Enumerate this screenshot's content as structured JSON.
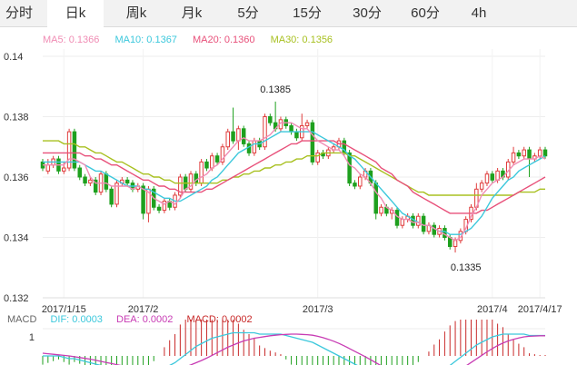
{
  "tabs": [
    {
      "label": "分时",
      "active": false
    },
    {
      "label": "日k",
      "active": true
    },
    {
      "label": "周k",
      "active": false
    },
    {
      "label": "月k",
      "active": false
    },
    {
      "label": "5分",
      "active": false
    },
    {
      "label": "15分",
      "active": false
    },
    {
      "label": "30分",
      "active": false
    },
    {
      "label": "60分",
      "active": false
    },
    {
      "label": "4h",
      "active": false
    }
  ],
  "legend": {
    "ma5": "MA5: 0.1366",
    "ma10": "MA10: 0.1367",
    "ma20": "MA20: 0.1360",
    "ma30": "MA30: 0.1356"
  },
  "macd_legend": {
    "title": "MACD",
    "dif": "DIF: 0.0003",
    "dea": "DEA: 0.0002",
    "macd": "MACD: 0.0002"
  },
  "colors": {
    "ma5": "#f08cb4",
    "ma10": "#3cc8dc",
    "ma20": "#e8507a",
    "ma30": "#a8c020",
    "up": "#e03c3c",
    "down": "#1ea01e",
    "dif": "#3cc8dc",
    "dea": "#c83cb4",
    "macd": "#c82828"
  },
  "chart_data": {
    "type": "candlestick",
    "y_ticks": [
      "0.14",
      "0.138",
      "0.136",
      "0.134",
      "0.132"
    ],
    "ylim": [
      0.132,
      0.14
    ],
    "x_labels": [
      {
        "label": "2017/1/15",
        "index": 4
      },
      {
        "label": "2017/2",
        "index": 19
      },
      {
        "label": "2017/3",
        "index": 52
      },
      {
        "label": "2017/4",
        "index": 85
      },
      {
        "label": "2017/4/17",
        "index": 94
      }
    ],
    "annotations": [
      {
        "text": "0.1385",
        "index": 44,
        "value": 0.1385
      },
      {
        "text": "0.1335",
        "index": 80,
        "value": 0.1335
      }
    ],
    "candles": [
      [
        0.1365,
        0.1363,
        0.1366,
        0.1362
      ],
      [
        0.1362,
        0.1364,
        0.1366,
        0.1361
      ],
      [
        0.1364,
        0.1366,
        0.1367,
        0.1363
      ],
      [
        0.1366,
        0.1362,
        0.1367,
        0.1361
      ],
      [
        0.1362,
        0.1363,
        0.1365,
        0.1361
      ],
      [
        0.1363,
        0.1375,
        0.1376,
        0.1362
      ],
      [
        0.1375,
        0.1363,
        0.1376,
        0.1362
      ],
      [
        0.1363,
        0.136,
        0.1364,
        0.1359
      ],
      [
        0.136,
        0.1358,
        0.1361,
        0.1357
      ],
      [
        0.1358,
        0.1359,
        0.136,
        0.1357
      ],
      [
        0.1359,
        0.1355,
        0.136,
        0.1354
      ],
      [
        0.1355,
        0.1361,
        0.1362,
        0.1354
      ],
      [
        0.1361,
        0.1356,
        0.1362,
        0.1355
      ],
      [
        0.1356,
        0.1351,
        0.1357,
        0.135
      ],
      [
        0.1351,
        0.1358,
        0.1359,
        0.135
      ],
      [
        0.1358,
        0.1359,
        0.136,
        0.1357
      ],
      [
        0.1359,
        0.1358,
        0.136,
        0.1357
      ],
      [
        0.1358,
        0.1356,
        0.1359,
        0.1355
      ],
      [
        0.1356,
        0.1357,
        0.1358,
        0.1355
      ],
      [
        0.1357,
        0.1348,
        0.1358,
        0.1346
      ],
      [
        0.1348,
        0.1356,
        0.1357,
        0.1345
      ],
      [
        0.1356,
        0.135,
        0.1357,
        0.1349
      ],
      [
        0.135,
        0.1349,
        0.1351,
        0.1348
      ],
      [
        0.1349,
        0.1352,
        0.1353,
        0.1348
      ],
      [
        0.1352,
        0.135,
        0.1353,
        0.1349
      ],
      [
        0.135,
        0.1354,
        0.1355,
        0.1349
      ],
      [
        0.1354,
        0.136,
        0.1361,
        0.1353
      ],
      [
        0.136,
        0.1356,
        0.1361,
        0.1355
      ],
      [
        0.1356,
        0.1361,
        0.1362,
        0.1355
      ],
      [
        0.1361,
        0.1358,
        0.1362,
        0.1357
      ],
      [
        0.1358,
        0.1365,
        0.1366,
        0.1357
      ],
      [
        0.1365,
        0.1363,
        0.1366,
        0.1362
      ],
      [
        0.1363,
        0.1367,
        0.1368,
        0.1362
      ],
      [
        0.1367,
        0.1365,
        0.1368,
        0.1364
      ],
      [
        0.1365,
        0.137,
        0.1371,
        0.1364
      ],
      [
        0.137,
        0.1375,
        0.1376,
        0.1369
      ],
      [
        0.1375,
        0.1372,
        0.1383,
        0.1371
      ],
      [
        0.1372,
        0.1376,
        0.1377,
        0.1369
      ],
      [
        0.1376,
        0.1371,
        0.1377,
        0.137
      ],
      [
        0.1371,
        0.1368,
        0.1372,
        0.1367
      ],
      [
        0.1368,
        0.1372,
        0.1373,
        0.1367
      ],
      [
        0.1372,
        0.137,
        0.1373,
        0.1369
      ],
      [
        0.137,
        0.138,
        0.1381,
        0.1369
      ],
      [
        0.138,
        0.1378,
        0.1381,
        0.1377
      ],
      [
        0.1378,
        0.1376,
        0.1385,
        0.1375
      ],
      [
        0.1376,
        0.1379,
        0.138,
        0.1375
      ],
      [
        0.1379,
        0.1377,
        0.138,
        0.1376
      ],
      [
        0.1377,
        0.1375,
        0.1378,
        0.1374
      ],
      [
        0.1375,
        0.1373,
        0.1376,
        0.1372
      ],
      [
        0.1373,
        0.1377,
        0.1381,
        0.1372
      ],
      [
        0.1377,
        0.1378,
        0.1379,
        0.1376
      ],
      [
        0.1378,
        0.1365,
        0.1379,
        0.1364
      ],
      [
        0.1365,
        0.1368,
        0.1369,
        0.1364
      ],
      [
        0.1368,
        0.1367,
        0.1369,
        0.1366
      ],
      [
        0.1367,
        0.1369,
        0.137,
        0.1366
      ],
      [
        0.1369,
        0.137,
        0.1371,
        0.1368
      ],
      [
        0.137,
        0.1372,
        0.1373,
        0.1369
      ],
      [
        0.1372,
        0.1368,
        0.1373,
        0.1367
      ],
      [
        0.1368,
        0.1358,
        0.1369,
        0.1357
      ],
      [
        0.1358,
        0.1357,
        0.1359,
        0.1356
      ],
      [
        0.1357,
        0.136,
        0.1361,
        0.1356
      ],
      [
        0.136,
        0.1362,
        0.1363,
        0.1359
      ],
      [
        0.1362,
        0.1358,
        0.1363,
        0.1357
      ],
      [
        0.1358,
        0.1348,
        0.1359,
        0.1346
      ],
      [
        0.1348,
        0.135,
        0.1351,
        0.1347
      ],
      [
        0.135,
        0.1348,
        0.1351,
        0.1347
      ],
      [
        0.1348,
        0.1349,
        0.135,
        0.1346
      ],
      [
        0.1349,
        0.1344,
        0.135,
        0.1343
      ],
      [
        0.1344,
        0.1346,
        0.1347,
        0.1343
      ],
      [
        0.1346,
        0.1347,
        0.1348,
        0.1345
      ],
      [
        0.1347,
        0.1344,
        0.1348,
        0.1343
      ],
      [
        0.1344,
        0.1347,
        0.1348,
        0.1343
      ],
      [
        0.1347,
        0.1342,
        0.1348,
        0.1341
      ],
      [
        0.1342,
        0.1344,
        0.1345,
        0.1341
      ],
      [
        0.1344,
        0.1341,
        0.1345,
        0.134
      ],
      [
        0.1341,
        0.1343,
        0.1344,
        0.134
      ],
      [
        0.1343,
        0.134,
        0.1344,
        0.1339
      ],
      [
        0.134,
        0.1337,
        0.1341,
        0.1336
      ],
      [
        0.1337,
        0.1339,
        0.134,
        0.1335
      ],
      [
        0.1339,
        0.1342,
        0.1343,
        0.1338
      ],
      [
        0.1342,
        0.1346,
        0.1347,
        0.1341
      ],
      [
        0.1346,
        0.135,
        0.1351,
        0.1345
      ],
      [
        0.135,
        0.1356,
        0.1358,
        0.1349
      ],
      [
        0.1356,
        0.1358,
        0.1359,
        0.1355
      ],
      [
        0.1358,
        0.1361,
        0.1362,
        0.1357
      ],
      [
        0.1361,
        0.1359,
        0.1362,
        0.1358
      ],
      [
        0.1359,
        0.1362,
        0.1363,
        0.1358
      ],
      [
        0.1362,
        0.136,
        0.1363,
        0.1359
      ],
      [
        0.136,
        0.1365,
        0.1366,
        0.1359
      ],
      [
        0.1365,
        0.1368,
        0.137,
        0.1364
      ],
      [
        0.1368,
        0.1367,
        0.1369,
        0.1366
      ],
      [
        0.1367,
        0.1369,
        0.137,
        0.1366
      ],
      [
        0.1369,
        0.1366,
        0.137,
        0.136
      ],
      [
        0.1366,
        0.1367,
        0.1368,
        0.1365
      ],
      [
        0.1367,
        0.1369,
        0.137,
        0.1366
      ],
      [
        0.1369,
        0.1367,
        0.137,
        0.1366
      ]
    ],
    "ma5": [
      0.1364,
      0.1364,
      0.1364,
      0.1364,
      0.1364,
      0.1366,
      0.1366,
      0.1365,
      0.1364,
      0.136,
      0.1358,
      0.1358,
      0.1358,
      0.1357,
      0.1357,
      0.1357,
      0.1357,
      0.1356,
      0.1357,
      0.1356,
      0.1355,
      0.1353,
      0.1352,
      0.1351,
      0.1352,
      0.1351,
      0.1353,
      0.1356,
      0.1357,
      0.1359,
      0.136,
      0.1361,
      0.1363,
      0.1364,
      0.1366,
      0.1368,
      0.137,
      0.1372,
      0.1373,
      0.1372,
      0.1372,
      0.1372,
      0.1373,
      0.1374,
      0.1376,
      0.1378,
      0.1378,
      0.1378,
      0.1377,
      0.1376,
      0.1376,
      0.1374,
      0.1372,
      0.1371,
      0.137,
      0.1369,
      0.1369,
      0.1367,
      0.1364,
      0.1363,
      0.1361,
      0.136,
      0.1358,
      0.1355,
      0.1353,
      0.135,
      0.1349,
      0.1347,
      0.1346,
      0.1346,
      0.1345,
      0.1345,
      0.1344,
      0.1344,
      0.1343,
      0.1342,
      0.1341,
      0.134,
      0.1339,
      0.134,
      0.1343,
      0.1347,
      0.135,
      0.1354,
      0.1356,
      0.1358,
      0.1359,
      0.136,
      0.1362,
      0.1364,
      0.1365,
      0.1366,
      0.1366,
      0.1366,
      0.1367,
      0.1366
    ],
    "ma10": [
      0.1365,
      0.1365,
      0.1365,
      0.1365,
      0.1365,
      0.1365,
      0.1365,
      0.1365,
      0.1364,
      0.1363,
      0.1362,
      0.1362,
      0.1361,
      0.136,
      0.1359,
      0.1358,
      0.1357,
      0.1357,
      0.1357,
      0.1356,
      0.1356,
      0.1355,
      0.1354,
      0.1353,
      0.1353,
      0.1352,
      0.1352,
      0.1353,
      0.1354,
      0.1355,
      0.1356,
      0.1357,
      0.1359,
      0.136,
      0.1362,
      0.1364,
      0.1366,
      0.1368,
      0.1369,
      0.137,
      0.1371,
      0.1371,
      0.1372,
      0.1373,
      0.1374,
      0.1375,
      0.1375,
      0.1375,
      0.1375,
      0.1375,
      0.1375,
      0.1375,
      0.1374,
      0.1373,
      0.1372,
      0.1371,
      0.137,
      0.1369,
      0.1367,
      0.1366,
      0.1364,
      0.1362,
      0.136,
      0.1358,
      0.1356,
      0.1354,
      0.1352,
      0.135,
      0.1348,
      0.1347,
      0.1346,
      0.1345,
      0.1344,
      0.1344,
      0.1343,
      0.1342,
      0.1342,
      0.1341,
      0.1341,
      0.1341,
      0.1342,
      0.1343,
      0.1345,
      0.1347,
      0.135,
      0.1353,
      0.1355,
      0.1357,
      0.1359,
      0.136,
      0.1362,
      0.1363,
      0.1364,
      0.1365,
      0.1366,
      0.1367
    ],
    "ma20": [
      0.1368,
      0.1368,
      0.1368,
      0.1368,
      0.1368,
      0.1368,
      0.1368,
      0.1368,
      0.1367,
      0.1367,
      0.1366,
      0.1366,
      0.1365,
      0.1364,
      0.1364,
      0.1363,
      0.1362,
      0.1361,
      0.136,
      0.1359,
      0.1359,
      0.1358,
      0.1357,
      0.1357,
      0.1356,
      0.1356,
      0.1355,
      0.1355,
      0.1355,
      0.1355,
      0.1355,
      0.1356,
      0.1356,
      0.1357,
      0.1358,
      0.1359,
      0.136,
      0.1361,
      0.1362,
      0.1363,
      0.1364,
      0.1365,
      0.1366,
      0.1367,
      0.1368,
      0.1369,
      0.137,
      0.1371,
      0.1371,
      0.1372,
      0.1372,
      0.1372,
      0.1372,
      0.1372,
      0.1372,
      0.1372,
      0.1371,
      0.1371,
      0.137,
      0.1369,
      0.1368,
      0.1367,
      0.1366,
      0.1365,
      0.1363,
      0.1362,
      0.1361,
      0.1359,
      0.1358,
      0.1357,
      0.1355,
      0.1354,
      0.1353,
      0.1352,
      0.1351,
      0.135,
      0.1349,
      0.1348,
      0.1348,
      0.1348,
      0.1348,
      0.1348,
      0.1348,
      0.1349,
      0.1349,
      0.135,
      0.1351,
      0.1352,
      0.1353,
      0.1354,
      0.1355,
      0.1356,
      0.1357,
      0.1358,
      0.1359,
      0.136
    ],
    "ma30": [
      0.1372,
      0.1372,
      0.1372,
      0.1372,
      0.1371,
      0.1371,
      0.1371,
      0.137,
      0.137,
      0.1369,
      0.1368,
      0.1368,
      0.1367,
      0.1366,
      0.1365,
      0.1365,
      0.1364,
      0.1363,
      0.1362,
      0.1361,
      0.1361,
      0.136,
      0.136,
      0.1359,
      0.1359,
      0.1358,
      0.1358,
      0.1358,
      0.1358,
      0.1358,
      0.1358,
      0.1358,
      0.1358,
      0.1358,
      0.1359,
      0.1359,
      0.136,
      0.136,
      0.1361,
      0.1361,
      0.1362,
      0.1362,
      0.1363,
      0.1363,
      0.1364,
      0.1364,
      0.1365,
      0.1365,
      0.1366,
      0.1366,
      0.1367,
      0.1367,
      0.1367,
      0.1368,
      0.1368,
      0.1368,
      0.1368,
      0.1368,
      0.1367,
      0.1367,
      0.1366,
      0.1365,
      0.1364,
      0.1363,
      0.1362,
      0.1361,
      0.136,
      0.1359,
      0.1358,
      0.1357,
      0.1356,
      0.1355,
      0.1355,
      0.1354,
      0.1354,
      0.1354,
      0.1354,
      0.1354,
      0.1354,
      0.1354,
      0.1354,
      0.1354,
      0.1354,
      0.1354,
      0.1354,
      0.1354,
      0.1354,
      0.1354,
      0.1354,
      0.1354,
      0.1355,
      0.1355,
      0.1355,
      0.1355,
      0.1356,
      0.1356
    ],
    "macd_panel": {
      "y_tick": "1",
      "dif": [
        0.0,
        0.0,
        0.0,
        0.0,
        -0.05,
        -0.1,
        -0.1,
        -0.15,
        -0.2,
        -0.25,
        -0.3,
        -0.35,
        -0.4,
        -0.45,
        -0.5,
        -0.5,
        -0.55,
        -0.6,
        -0.6,
        -0.65,
        -0.65,
        -0.6,
        -0.55,
        -0.45,
        -0.35,
        -0.25,
        -0.1,
        0.05,
        0.2,
        0.35,
        0.45,
        0.55,
        0.65,
        0.7,
        0.75,
        0.8,
        0.85,
        0.85,
        0.85,
        0.85,
        0.85,
        0.8,
        0.8,
        0.8,
        0.8,
        0.8,
        0.75,
        0.7,
        0.65,
        0.6,
        0.55,
        0.5,
        0.4,
        0.3,
        0.2,
        0.1,
        0.0,
        -0.1,
        -0.2,
        -0.3,
        -0.4,
        -0.5,
        -0.6,
        -0.7,
        -0.8,
        -0.9,
        -0.95,
        -1.0,
        -1.0,
        -1.0,
        -1.0,
        -0.95,
        -0.9,
        -0.85,
        -0.75,
        -0.65,
        -0.5,
        -0.35,
        -0.2,
        -0.05,
        0.1,
        0.25,
        0.4,
        0.5,
        0.6,
        0.7,
        0.75,
        0.8,
        0.8,
        0.8,
        0.8,
        0.8,
        0.75,
        0.75,
        0.75,
        0.75
      ],
      "dea": [
        0.1,
        0.08,
        0.06,
        0.04,
        0.02,
        0.0,
        -0.03,
        -0.06,
        -0.09,
        -0.12,
        -0.16,
        -0.2,
        -0.24,
        -0.28,
        -0.32,
        -0.36,
        -0.4,
        -0.44,
        -0.47,
        -0.5,
        -0.52,
        -0.54,
        -0.55,
        -0.55,
        -0.53,
        -0.5,
        -0.46,
        -0.4,
        -0.33,
        -0.25,
        -0.17,
        -0.08,
        0.02,
        0.12,
        0.22,
        0.32,
        0.4,
        0.48,
        0.55,
        0.6,
        0.65,
        0.68,
        0.71,
        0.74,
        0.76,
        0.78,
        0.79,
        0.8,
        0.8,
        0.79,
        0.78,
        0.76,
        0.72,
        0.67,
        0.61,
        0.54,
        0.46,
        0.37,
        0.27,
        0.17,
        0.07,
        -0.03,
        -0.14,
        -0.25,
        -0.36,
        -0.46,
        -0.56,
        -0.65,
        -0.73,
        -0.8,
        -0.85,
        -0.88,
        -0.9,
        -0.9,
        -0.88,
        -0.84,
        -0.78,
        -0.7,
        -0.6,
        -0.49,
        -0.37,
        -0.24,
        -0.11,
        0.02,
        0.15,
        0.27,
        0.38,
        0.47,
        0.55,
        0.61,
        0.66,
        0.7,
        0.72,
        0.73,
        0.74,
        0.74
      ]
    }
  }
}
